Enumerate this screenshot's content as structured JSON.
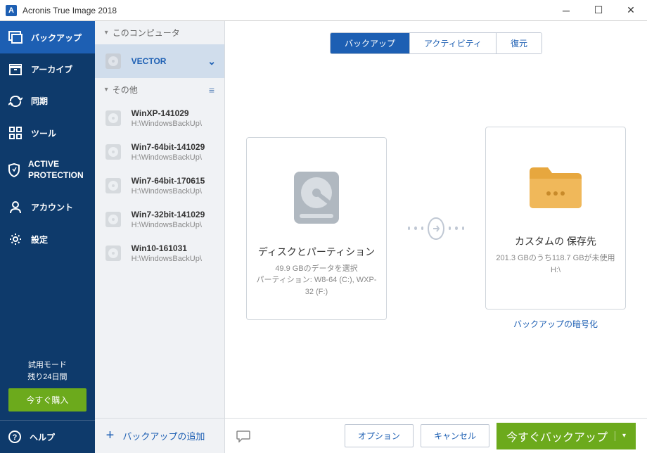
{
  "app": {
    "title": "Acronis True Image 2018"
  },
  "sidebar": {
    "backup": "バックアップ",
    "archive": "アーカイブ",
    "sync": "同期",
    "tools": "ツール",
    "active_protection": "ACTIVE PROTECTION",
    "account": "アカウント",
    "settings": "設定",
    "trial_mode": "試用モード",
    "trial_days": "残り24日間",
    "buy_now": "今すぐ購入",
    "help": "ヘルプ"
  },
  "list": {
    "section_this": "このコンピュータ",
    "section_other": "その他",
    "selected": {
      "title": "VECTOR"
    },
    "items": [
      {
        "title": "WinXP-141029",
        "sub": "H:\\WindowsBackUp\\"
      },
      {
        "title": "Win7-64bit-141029",
        "sub": "H:\\WindowsBackUp\\"
      },
      {
        "title": "Win7-64bit-170615",
        "sub": "H:\\WindowsBackUp\\"
      },
      {
        "title": "Win7-32bit-141029",
        "sub": "H:\\WindowsBackUp\\"
      },
      {
        "title": "Win10-161031",
        "sub": "H:\\WindowsBackUp\\"
      }
    ],
    "add_backup": "バックアップの追加"
  },
  "tabs": {
    "backup": "バックアップ",
    "activity": "アクティビティ",
    "restore": "復元"
  },
  "source_card": {
    "title": "ディスクとパーティション",
    "line1": "49.9 GBのデータを選択",
    "line2": "パーティション: W8-64 (C:), WXP-32 (F:)"
  },
  "dest_card": {
    "title": "カスタムの 保存先",
    "line1": "201.3 GBのうち118.7 GBが未使用",
    "line2": "H:\\"
  },
  "encrypt_link": "バックアップの暗号化",
  "actions": {
    "options": "オプション",
    "cancel": "キャンセル",
    "backup_now": "今すぐバックアップ"
  }
}
